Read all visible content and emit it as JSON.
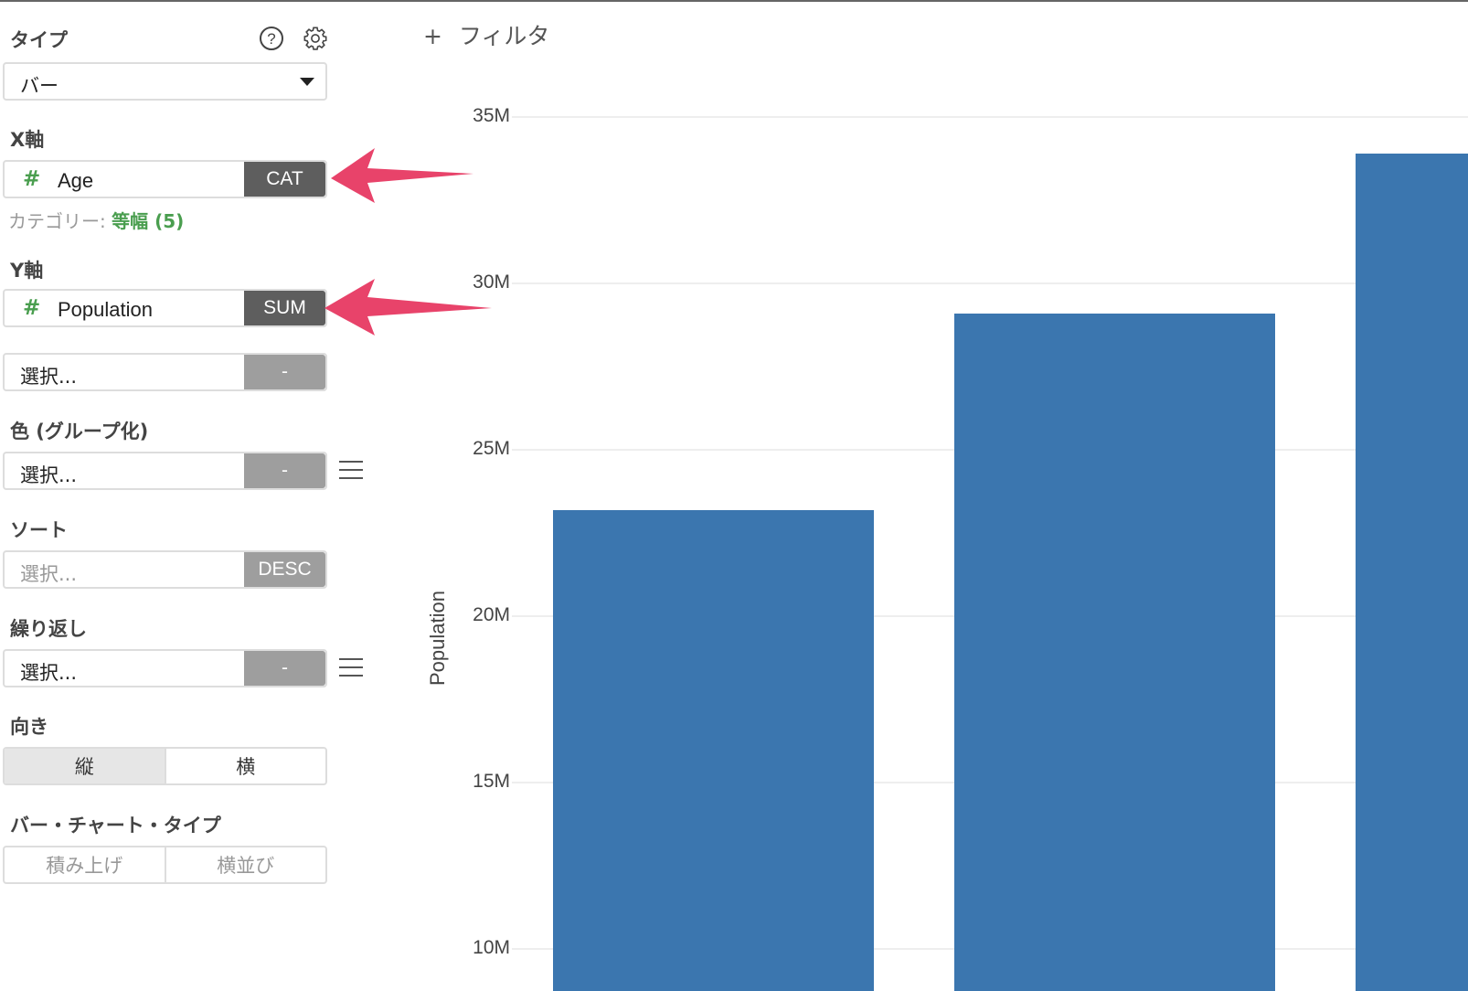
{
  "panel": {
    "type_label": "タイプ",
    "type_value": "バー",
    "x_axis": {
      "label": "X軸",
      "field_icon": "#",
      "field": "Age",
      "button": "CAT",
      "category_prefix": "カテゴリー:",
      "category_value": "等幅 (5)"
    },
    "y_axis": {
      "label": "Y軸",
      "field_icon": "#",
      "field": "Population",
      "button": "SUM",
      "second_placeholder": "選択...",
      "second_button": "-"
    },
    "color": {
      "label": "色 (グループ化)",
      "placeholder": "選択...",
      "button": "-"
    },
    "sort": {
      "label": "ソート",
      "placeholder": "選択...",
      "button": "DESC"
    },
    "repeat": {
      "label": "繰り返し",
      "placeholder": "選択...",
      "button": "-"
    },
    "orientation": {
      "label": "向き",
      "options": [
        "縦",
        "横"
      ],
      "selected": "縦"
    },
    "bar_chart_type": {
      "label": "バー・チャート・タイプ",
      "options": [
        "積み上げ",
        "横並び"
      ]
    }
  },
  "filter": {
    "icon": "+",
    "label": "フィルタ"
  },
  "colors": {
    "accent_green": "#4a9e4f",
    "bar": "#3b76af",
    "arrow": "#e8436a"
  },
  "chart_data": {
    "type": "bar",
    "ylabel": "Population",
    "yticks": [
      "35M",
      "30M",
      "25M",
      "20M",
      "15M",
      "10M"
    ],
    "ytick_values": [
      35000000,
      30000000,
      25000000,
      20000000,
      15000000,
      10000000
    ],
    "values": [
      23200000,
      29100000,
      33900000
    ],
    "grid": true
  }
}
